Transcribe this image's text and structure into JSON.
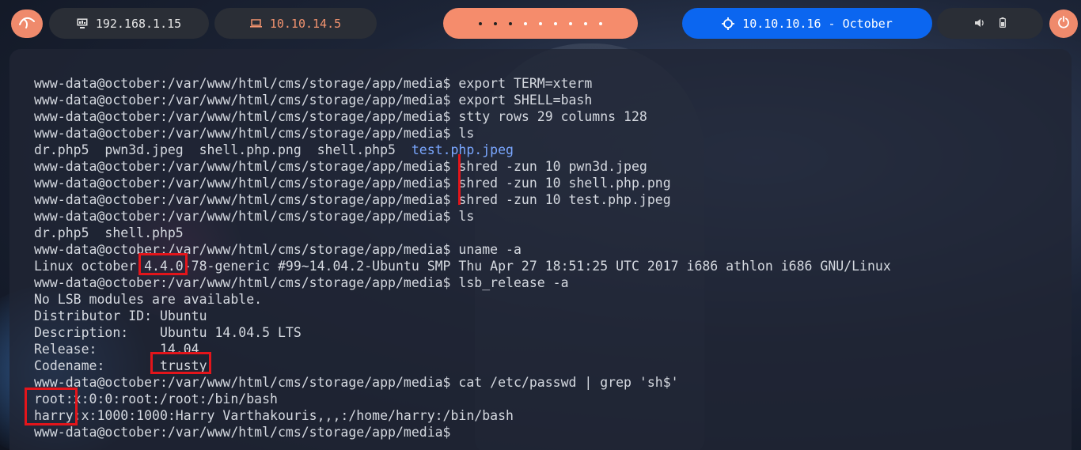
{
  "topbar": {
    "host_ip": "192.168.1.15",
    "vpn_ip": "10.10.14.5",
    "target_label": "10.10.10.16 - October",
    "icons": {
      "logo": "kali-dragon-icon",
      "host": "monitor-icon",
      "vpn": "laptop-icon",
      "target": "crosshair-icon",
      "volume": "volume-icon",
      "battery": "battery-icon",
      "power": "power-icon"
    },
    "colors": {
      "accent": "#ef8a6c",
      "target_bg": "#0b66f0",
      "pill_bg": "#2a2e36"
    }
  },
  "terminal": {
    "lines": [
      "www-data@october:/var/www/html/cms/storage/app/media$ export TERM=xterm",
      "www-data@october:/var/www/html/cms/storage/app/media$ export SHELL=bash",
      "www-data@october:/var/www/html/cms/storage/app/media$ stty rows 29 columns 128",
      "www-data@october:/var/www/html/cms/storage/app/media$ ls",
      "dr.php5  pwn3d.jpeg  shell.php.png  shell.php5  ",
      "www-data@october:/var/www/html/cms/storage/app/media$ shred -zun 10 pwn3d.jpeg",
      "www-data@october:/var/www/html/cms/storage/app/media$ shred -zun 10 shell.php.png",
      "www-data@october:/var/www/html/cms/storage/app/media$ shred -zun 10 test.php.jpeg",
      "www-data@october:/var/www/html/cms/storage/app/media$ ls",
      "dr.php5  shell.php5",
      "www-data@october:/var/www/html/cms/storage/app/media$ uname -a",
      "Linux october 4.4.0-78-generic #99~14.04.2-Ubuntu SMP Thu Apr 27 18:51:25 UTC 2017 i686 athlon i686 GNU/Linux",
      "www-data@october:/var/www/html/cms/storage/app/media$ lsb_release -a",
      "No LSB modules are available.",
      "Distributor ID: Ubuntu",
      "Description:    Ubuntu 14.04.5 LTS",
      "Release:        14.04",
      "Codename:       trusty",
      "www-data@october:/var/www/html/cms/storage/app/media$ cat /etc/passwd | grep 'sh$'",
      "root:x:0:0:root:/root:/bin/bash",
      "harry:x:1000:1000:Harry Varthakouris,,,:/home/harry:/bin/bash",
      "www-data@october:/var/www/html/cms/storage/app/media$ "
    ],
    "highlighted_file": "test.php.jpeg",
    "text_color": "#d5d9e0",
    "highlight_color": "#7aa7ff",
    "annotation_color": "#e3151b"
  }
}
